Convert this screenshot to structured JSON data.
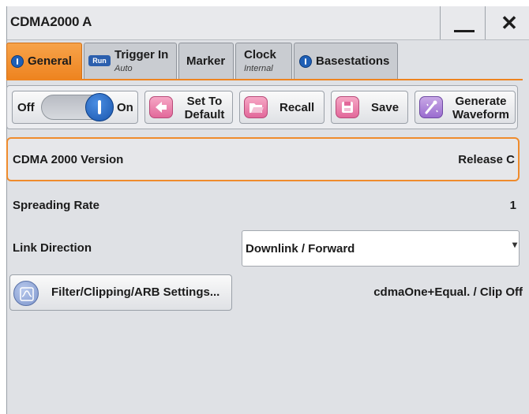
{
  "window": {
    "title": "CDMA2000 A",
    "minimize_icon": "minimize-icon",
    "close_label": "✕"
  },
  "tabs": [
    {
      "label": "General",
      "sub": "",
      "icon": "info-icon"
    },
    {
      "label": "Trigger In",
      "sub": "Auto",
      "icon": "run-icon",
      "icon_text": "Run"
    },
    {
      "label": "Marker",
      "sub": ""
    },
    {
      "label": "Clock",
      "sub": "Internal"
    },
    {
      "label": "Basestations",
      "sub": "",
      "icon": "info-icon"
    }
  ],
  "toolbar": {
    "toggle_off": "Off",
    "toggle_on": "On",
    "toggle_state": "On",
    "set_default_1": "Set To",
    "set_default_2": "Default",
    "recall": "Recall",
    "save": "Save",
    "generate_1": "Generate",
    "generate_2": "Waveform"
  },
  "settings": {
    "version_label": "CDMA 2000 Version",
    "version_value": "Release C",
    "spreading_label": "Spreading Rate",
    "spreading_value": "1",
    "link_label": "Link Direction",
    "link_value": "Downlink / Forward",
    "filter_button": "Filter/Clipping/ARB Settings...",
    "filter_status": "cdmaOne+Equal. / Clip Off"
  },
  "colors": {
    "accent": "#ee8420",
    "info_blue": "#1e5fb6",
    "background": "#dfe1e5"
  }
}
